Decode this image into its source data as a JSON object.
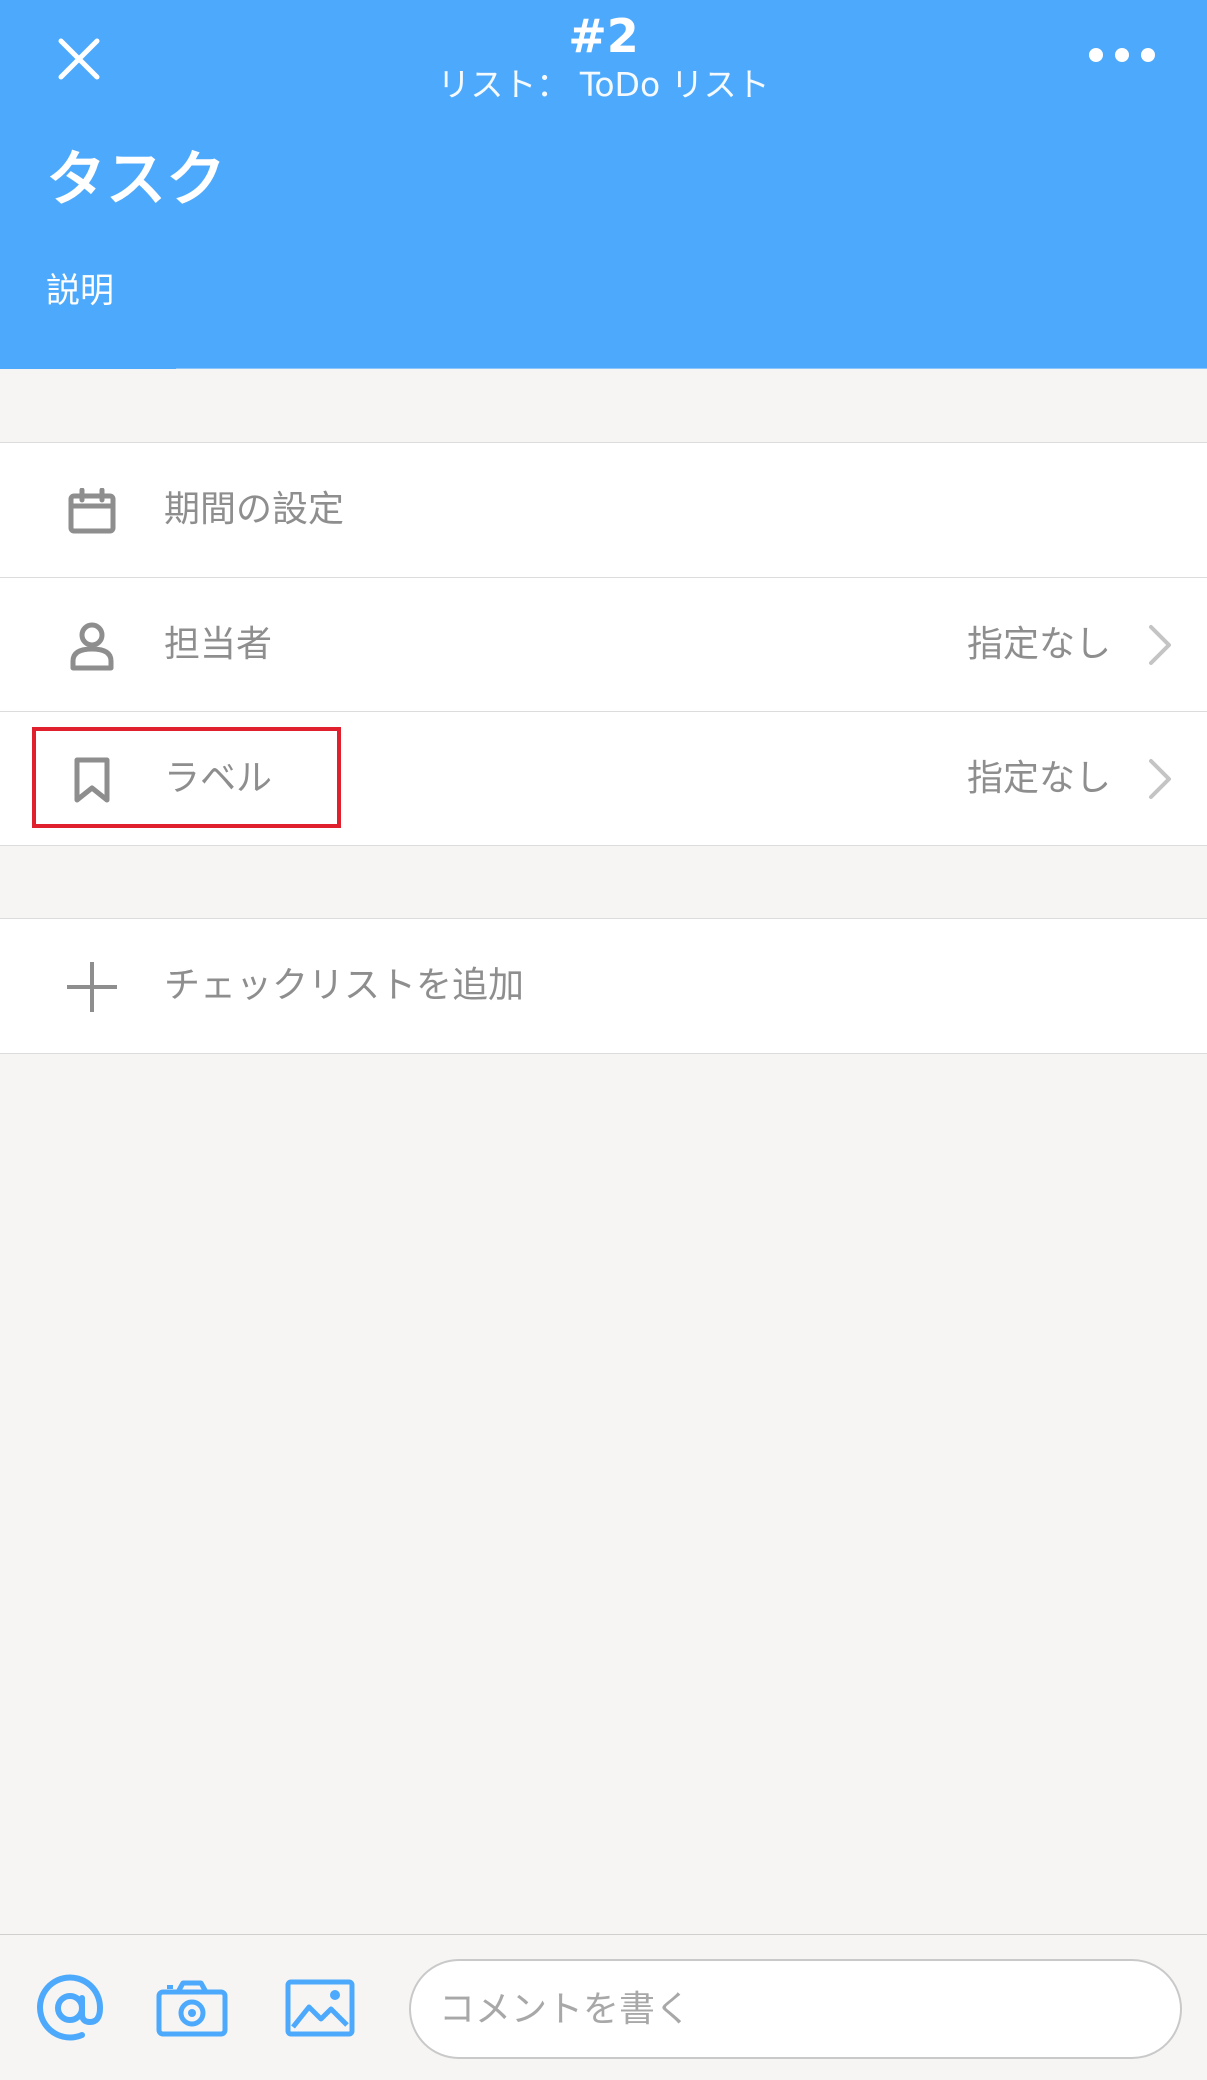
{
  "header": {
    "number": "#2",
    "list_caption": "リスト： ToDo リスト",
    "task_title": "タスク",
    "description_placeholder": "説明",
    "background_color": "#4da9fc"
  },
  "rows_group1": [
    {
      "name": "period",
      "icon": "calendar-icon",
      "label": "期間の設定",
      "value": ""
    },
    {
      "name": "assignee",
      "icon": "person-icon",
      "label": "担当者",
      "value": "指定なし"
    },
    {
      "name": "label",
      "icon": "bookmark-icon",
      "label": "ラベル",
      "value": "指定なし"
    }
  ],
  "rows_group2": [
    {
      "name": "checklist",
      "icon": "plus-icon",
      "label": "チェックリストを追加"
    }
  ],
  "bottom_bar": {
    "comment_placeholder": "コメントを書く",
    "icons": [
      "at-icon",
      "camera-icon",
      "image-icon"
    ],
    "accent_color": "#4da9fc"
  },
  "highlight_color": "#e0202c"
}
